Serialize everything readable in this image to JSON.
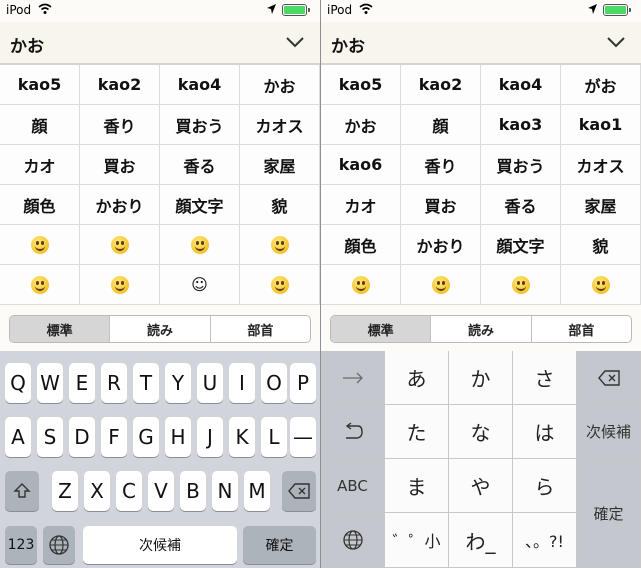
{
  "status": {
    "carrier": "iPod"
  },
  "input": {
    "text": "かお"
  },
  "left": {
    "candidates": [
      [
        "kao5",
        "kao2",
        "kao4",
        "かお"
      ],
      [
        "顔",
        "香り",
        "買おう",
        "カオス"
      ],
      [
        "カオ",
        "買お",
        "香る",
        "家屋"
      ],
      [
        "顔色",
        "かおり",
        "顔文字",
        "貌"
      ]
    ],
    "emoji_rows": [
      [
        "grinning-emoji",
        "grinning-emoji",
        "grinning-emoji",
        "laughing-emoji"
      ],
      [
        "sweat-smile-emoji",
        "smile-emoji",
        "☺",
        "relieved-emoji"
      ]
    ]
  },
  "right": {
    "candidates": [
      [
        "kao5",
        "kao2",
        "kao4",
        "がお"
      ],
      [
        "かお",
        "顔",
        "kao3",
        "kao1"
      ],
      [
        "kao6",
        "香り",
        "買おう",
        "カオス"
      ],
      [
        "カオ",
        "買お",
        "香る",
        "家屋"
      ],
      [
        "顔色",
        "かおり",
        "顔文字",
        "貌"
      ]
    ],
    "emoji_rows": [
      [
        "grinning-emoji",
        "grinning-emoji",
        "grinning-emoji",
        "laughing-emoji"
      ]
    ]
  },
  "segments": [
    "標準",
    "読み",
    "部首"
  ],
  "qwerty": {
    "row1": [
      "Q",
      "W",
      "E",
      "R",
      "T",
      "Y",
      "U",
      "I",
      "O",
      "P"
    ],
    "row2": [
      "A",
      "S",
      "D",
      "F",
      "G",
      "H",
      "J",
      "K",
      "L",
      "—"
    ],
    "row3": [
      "Z",
      "X",
      "C",
      "V",
      "B",
      "N",
      "M"
    ],
    "num_label": "123",
    "space_label": "次候補",
    "confirm_label": "確定"
  },
  "kana": {
    "row1": [
      "あ",
      "か",
      "さ"
    ],
    "row2": [
      "た",
      "な",
      "は"
    ],
    "row3": [
      "ま",
      "や",
      "ら"
    ],
    "row4": [
      "゛゜小",
      "わ_",
      "、。?!"
    ],
    "abc_label": "ABC",
    "next_label": "次候補",
    "confirm_label": "確定"
  }
}
